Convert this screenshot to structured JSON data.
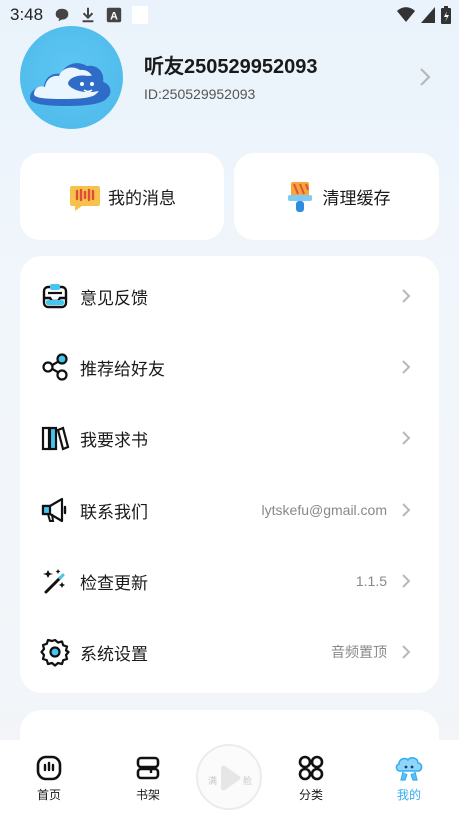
{
  "status_bar": {
    "time": "3:48"
  },
  "profile": {
    "nickname": "听友250529952093",
    "id_text": "ID:250529952093"
  },
  "quick_actions": [
    {
      "label": "我的消息",
      "icon": "message-icon"
    },
    {
      "label": "清理缓存",
      "icon": "clean-brush-icon"
    }
  ],
  "menu": [
    {
      "label": "意见反馈",
      "icon": "feedback-inbox-icon",
      "value": ""
    },
    {
      "label": "推荐给好友",
      "icon": "share-icon",
      "value": ""
    },
    {
      "label": "我要求书",
      "icon": "books-icon",
      "value": ""
    },
    {
      "label": "联系我们",
      "icon": "megaphone-icon",
      "value": "lytskefu@gmail.com"
    },
    {
      "label": "检查更新",
      "icon": "magic-wand-icon",
      "value": "1.1.5"
    },
    {
      "label": "系统设置",
      "icon": "gear-icon",
      "value": "音频置顶"
    }
  ],
  "tabbar": {
    "tabs": [
      {
        "label": "首页",
        "icon": "home-icon"
      },
      {
        "label": "书架",
        "icon": "bookshelf-icon"
      },
      {
        "label": "分类",
        "icon": "category-grid-icon"
      },
      {
        "label": "我的",
        "icon": "mine-cloud-icon",
        "active": true
      }
    ],
    "player_text_left": "满",
    "player_text_right": "脸"
  },
  "colors": {
    "accent": "#35aef2",
    "avatar_bg": "#4bb9ea"
  }
}
